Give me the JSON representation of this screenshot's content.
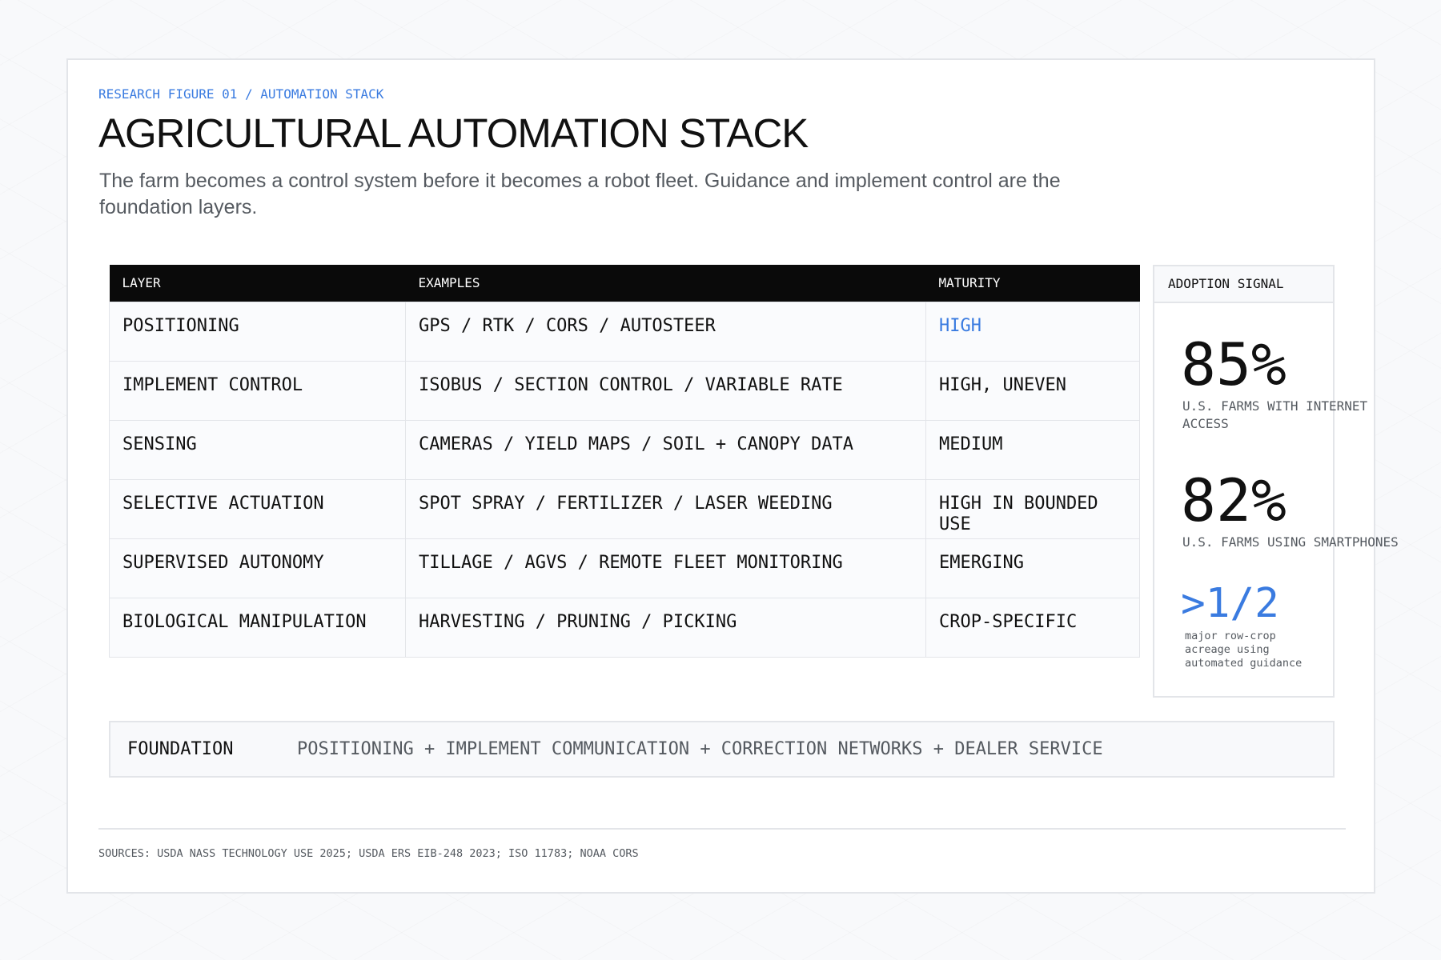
{
  "eyebrow": "RESEARCH FIGURE 01 / AUTOMATION STACK",
  "title": "AGRICULTURAL AUTOMATION STACK",
  "subtitle": "The farm becomes a control system before it becomes a robot fleet. Guidance and implement control are the foundation layers.",
  "table": {
    "headers": [
      "LAYER",
      "EXAMPLES",
      "MATURITY"
    ],
    "rows": [
      {
        "layer": "POSITIONING",
        "examples": "GPS / RTK / CORS / AUTOSTEER",
        "maturity": "HIGH",
        "maturity_highlight": true
      },
      {
        "layer": "IMPLEMENT CONTROL",
        "examples": "ISOBUS / SECTION CONTROL / VARIABLE RATE",
        "maturity": "HIGH, UNEVEN"
      },
      {
        "layer": "SENSING",
        "examples": "CAMERAS / YIELD MAPS / SOIL + CANOPY DATA",
        "maturity": "MEDIUM"
      },
      {
        "layer": "SELECTIVE ACTUATION",
        "examples": "SPOT SPRAY / FERTILIZER / LASER WEEDING",
        "maturity": "HIGH IN BOUNDED USE"
      },
      {
        "layer": "SUPERVISED AUTONOMY",
        "examples": "TILLAGE / AGVS / REMOTE FLEET MONITORING",
        "maturity": "EMERGING"
      },
      {
        "layer": "BIOLOGICAL MANIPULATION",
        "examples": "HARVESTING / PRUNING / PICKING",
        "maturity": "CROP-SPECIFIC"
      }
    ]
  },
  "adoption_signal": {
    "heading": "ADOPTION SIGNAL",
    "stats": [
      {
        "value": "85%",
        "label": "U.S. FARMS WITH INTERNET ACCESS"
      },
      {
        "value": "82%",
        "label": "U.S. FARMS USING SMARTPHONES"
      }
    ],
    "highlight": {
      "value": ">1/2",
      "label": "major row-crop acreage using automated guidance"
    }
  },
  "foundation": {
    "label": "FOUNDATION",
    "text": "POSITIONING + IMPLEMENT COMMUNICATION + CORRECTION NETWORKS + DEALER SERVICE"
  },
  "sources": "SOURCES: USDA NASS TECHNOLOGY USE 2025; USDA ERS EIB-248 2023; ISO 11783; NOAA CORS",
  "colors": {
    "accent": "#3a7be0",
    "header_bg": "#0a0a0a",
    "text": "#111111",
    "muted": "#555a60",
    "border": "#e3e5e9"
  }
}
